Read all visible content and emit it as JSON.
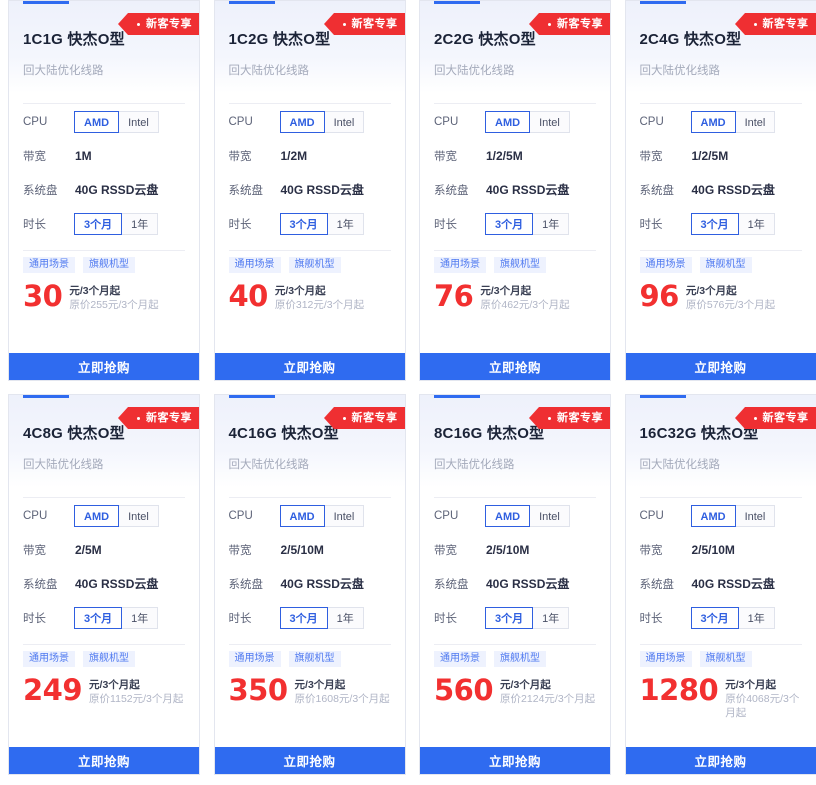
{
  "labels": {
    "cpu": "CPU",
    "bandwidth": "带宽",
    "disk": "系统盘",
    "duration": "时长",
    "badge": "新客专享",
    "buy": "立即抢购",
    "unit": "元/3个月起",
    "orig_prefix": "原价",
    "orig_suffix": "元/3个月起",
    "subtitle": "回大陆优化线路",
    "cpu_amd": "AMD",
    "cpu_intel": "Intel",
    "dur_3m": "3个月",
    "dur_1y": "1年",
    "tag_general": "通用场景",
    "tag_flagship": "旗舰机型"
  },
  "colors": {
    "accent": "#2f6bf0",
    "price": "#f23030",
    "badge": "#ef2f32",
    "tag_text": "#4f79f0",
    "tag_bg": "#eef2fe"
  },
  "cards": [
    {
      "title": "1C1G 快杰O型",
      "subtitle": "回大陆优化线路",
      "badge": "新客专享",
      "cpu_selected": "AMD",
      "bandwidth": "1M",
      "disk": "40G RSSD云盘",
      "duration_selected": "3个月",
      "tags": [
        "通用场景",
        "旗舰机型"
      ],
      "price": "30",
      "price_unit": "元/3个月起",
      "original": "原价255元/3个月起",
      "buy": "立即抢购"
    },
    {
      "title": "1C2G 快杰O型",
      "subtitle": "回大陆优化线路",
      "badge": "新客专享",
      "cpu_selected": "AMD",
      "bandwidth": "1/2M",
      "disk": "40G RSSD云盘",
      "duration_selected": "3个月",
      "tags": [
        "通用场景",
        "旗舰机型"
      ],
      "price": "40",
      "price_unit": "元/3个月起",
      "original": "原价312元/3个月起",
      "buy": "立即抢购"
    },
    {
      "title": "2C2G 快杰O型",
      "subtitle": "回大陆优化线路",
      "badge": "新客专享",
      "cpu_selected": "AMD",
      "bandwidth": "1/2/5M",
      "disk": "40G RSSD云盘",
      "duration_selected": "3个月",
      "tags": [
        "通用场景",
        "旗舰机型"
      ],
      "price": "76",
      "price_unit": "元/3个月起",
      "original": "原价462元/3个月起",
      "buy": "立即抢购"
    },
    {
      "title": "2C4G 快杰O型",
      "subtitle": "回大陆优化线路",
      "badge": "新客专享",
      "cpu_selected": "AMD",
      "bandwidth": "1/2/5M",
      "disk": "40G RSSD云盘",
      "duration_selected": "3个月",
      "tags": [
        "通用场景",
        "旗舰机型"
      ],
      "price": "96",
      "price_unit": "元/3个月起",
      "original": "原价576元/3个月起",
      "buy": "立即抢购"
    },
    {
      "title": "4C8G 快杰O型",
      "subtitle": "回大陆优化线路",
      "badge": "新客专享",
      "cpu_selected": "AMD",
      "bandwidth": "2/5M",
      "disk": "40G RSSD云盘",
      "duration_selected": "3个月",
      "tags": [
        "通用场景",
        "旗舰机型"
      ],
      "price": "249",
      "price_unit": "元/3个月起",
      "original": "原价1152元/3个月起",
      "buy": "立即抢购"
    },
    {
      "title": "4C16G 快杰O型",
      "subtitle": "回大陆优化线路",
      "badge": "新客专享",
      "cpu_selected": "AMD",
      "bandwidth": "2/5/10M",
      "disk": "40G RSSD云盘",
      "duration_selected": "3个月",
      "tags": [
        "通用场景",
        "旗舰机型"
      ],
      "price": "350",
      "price_unit": "元/3个月起",
      "original": "原价1608元/3个月起",
      "buy": "立即抢购"
    },
    {
      "title": "8C16G 快杰O型",
      "subtitle": "回大陆优化线路",
      "badge": "新客专享",
      "cpu_selected": "AMD",
      "bandwidth": "2/5/10M",
      "disk": "40G RSSD云盘",
      "duration_selected": "3个月",
      "tags": [
        "通用场景",
        "旗舰机型"
      ],
      "price": "560",
      "price_unit": "元/3个月起",
      "original": "原价2124元/3个月起",
      "buy": "立即抢购"
    },
    {
      "title": "16C32G 快杰O型",
      "subtitle": "回大陆优化线路",
      "badge": "新客专享",
      "cpu_selected": "AMD",
      "bandwidth": "2/5/10M",
      "disk": "40G RSSD云盘",
      "duration_selected": "3个月",
      "tags": [
        "通用场景",
        "旗舰机型"
      ],
      "price": "1280",
      "price_unit": "元/3个月起",
      "original": "原价4068元/3个月起",
      "buy": "立即抢购"
    }
  ]
}
